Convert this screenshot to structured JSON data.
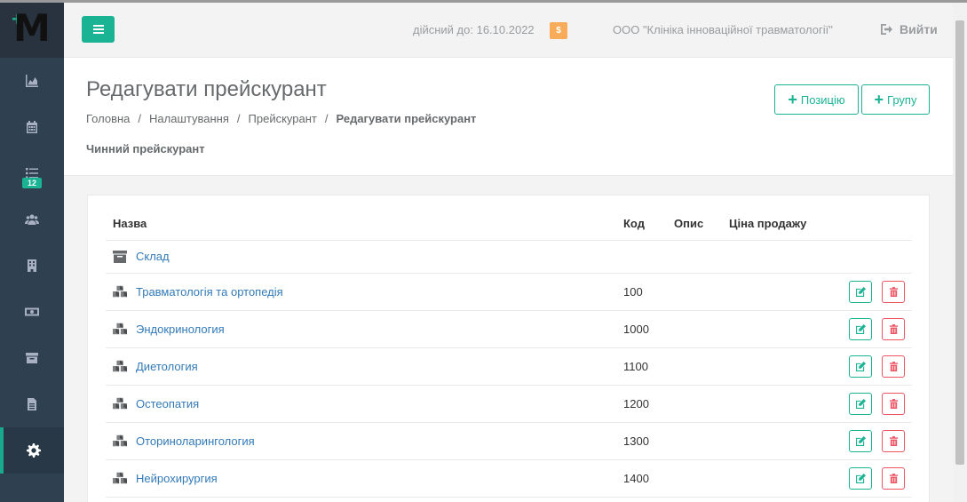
{
  "header": {
    "valid_until": "дійсний до: 16.10.2022",
    "currency_badge": "$",
    "organization": "ООО \"Клініка інноваційної травматології\"",
    "logout": "Вийти"
  },
  "sidebar": {
    "logo": "M",
    "items": [
      {
        "icon": "chart-icon"
      },
      {
        "icon": "calendar-icon"
      },
      {
        "icon": "list-icon",
        "badge": "12"
      },
      {
        "icon": "users-icon"
      },
      {
        "icon": "building-icon"
      },
      {
        "icon": "money-icon"
      },
      {
        "icon": "archive-icon"
      },
      {
        "icon": "file-icon"
      },
      {
        "icon": "gear-icon",
        "active": true
      }
    ]
  },
  "page": {
    "title": "Редагувати прейскурант",
    "breadcrumb": [
      "Головна",
      "Налаштування",
      "Прейскурант",
      "Редагувати прейскурант"
    ],
    "subtitle": "Чинний прейскурант",
    "btn_position": "Позицію",
    "btn_group": "Групу"
  },
  "table": {
    "columns": [
      "Назва",
      "Код",
      "Опис",
      "Ціна продажу"
    ],
    "folder": {
      "name": "Склад"
    },
    "rows": [
      {
        "name": "Травматологія та ортопедія",
        "code": "100"
      },
      {
        "name": "Эндокринология",
        "code": "1000"
      },
      {
        "name": "Диетология",
        "code": "1100"
      },
      {
        "name": "Остеопатия",
        "code": "1200"
      },
      {
        "name": "Оториноларингология",
        "code": "1300"
      },
      {
        "name": "Нейрохирургия",
        "code": "1400"
      }
    ]
  },
  "colors": {
    "accent": "#1ab394",
    "danger": "#ed5565",
    "warning": "#f8ac59",
    "sidebar": "#2f4050",
    "link": "#337ab7"
  }
}
